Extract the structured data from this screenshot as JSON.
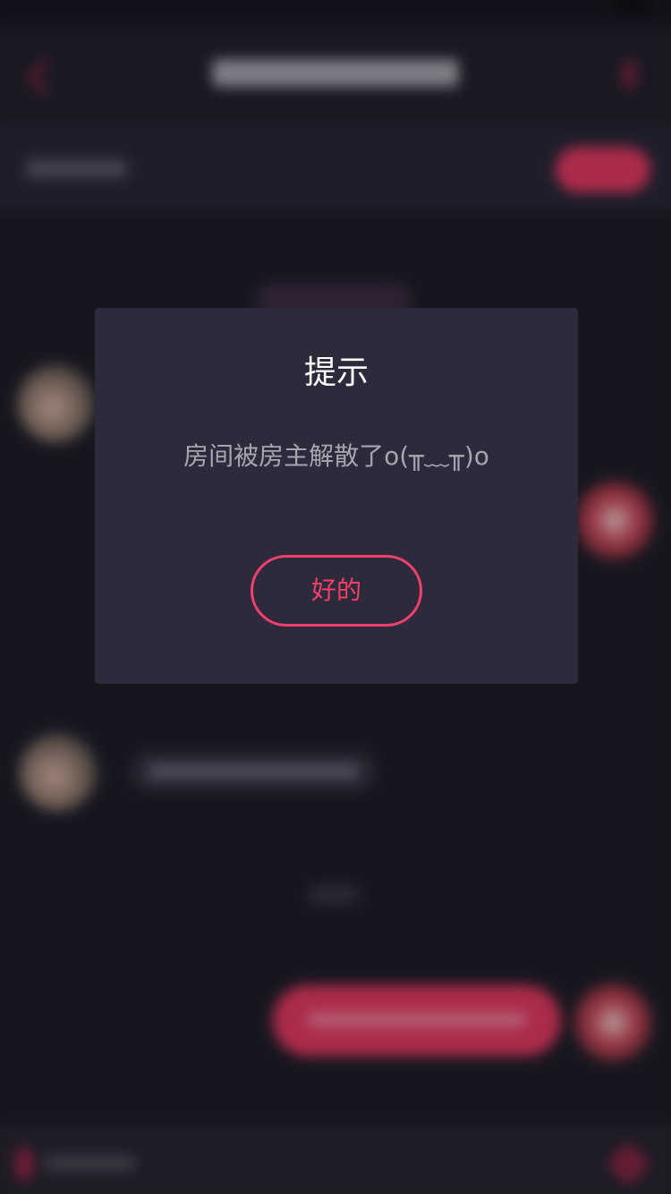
{
  "dialog": {
    "title": "提示",
    "message": "房间被房主解散了o(╥﹏╥)o",
    "ok_label": "好的"
  },
  "colors": {
    "accent": "#f0406b",
    "dialog_bg": "#2c2a3b",
    "app_bg": "#1b1a25"
  }
}
